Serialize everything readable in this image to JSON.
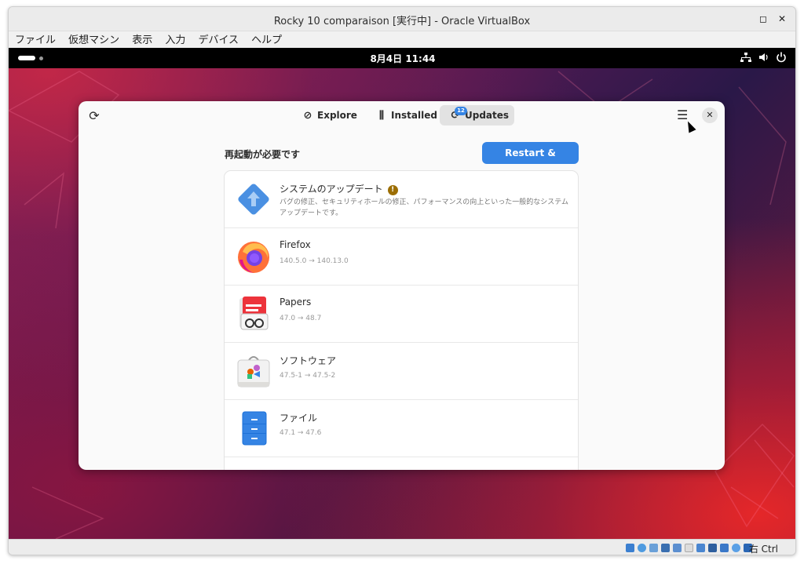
{
  "vbox": {
    "title": "Rocky 10 comparaison [実行中] - Oracle VirtualBox",
    "maximize_glyph": "◻",
    "close_glyph": "✕",
    "menu": [
      "ファイル",
      "仮想マシン",
      "表示",
      "入力",
      "デバイス",
      "ヘルプ"
    ],
    "host_key": "右 Ctrl"
  },
  "gnome": {
    "clock": "8月4日  11:44",
    "tray_icons": [
      "network-icon",
      "volume-icon",
      "power-icon"
    ]
  },
  "app": {
    "tabs": [
      {
        "label": "Explore",
        "icon": "compass-icon",
        "glyph": "⊘"
      },
      {
        "label": "Installed",
        "icon": "library-icon",
        "glyph": "⫼"
      },
      {
        "label": "Updates",
        "icon": "sync-icon",
        "glyph": "⟳"
      }
    ],
    "updates_badge": "12",
    "refresh_glyph": "⟳",
    "menu_glyph": "☰",
    "close_glyph": "✕",
    "section_title": "再起動が必要です",
    "restart_button": "Restart & Update…",
    "updates": [
      {
        "name": "システムのアップデート",
        "description": "バグの修正、セキュリティホールの修正、パフォーマンスの向上といった一般的なシステムアップデートです。",
        "icon": "system-update-icon",
        "warning": "!"
      },
      {
        "name": "Firefox",
        "version": "140.5.0 → 140.13.0",
        "icon": "firefox-icon"
      },
      {
        "name": "Papers",
        "version": "47.0 → 48.7",
        "icon": "papers-icon"
      },
      {
        "name": "ソフトウェア",
        "version": "47.5-1 → 47.5-2",
        "icon": "software-icon"
      },
      {
        "name": "ファイル",
        "version": "47.1 → 47.6",
        "icon": "files-icon"
      }
    ]
  },
  "colors": {
    "accent": "#3584e4",
    "warning": "#9c6e03"
  }
}
